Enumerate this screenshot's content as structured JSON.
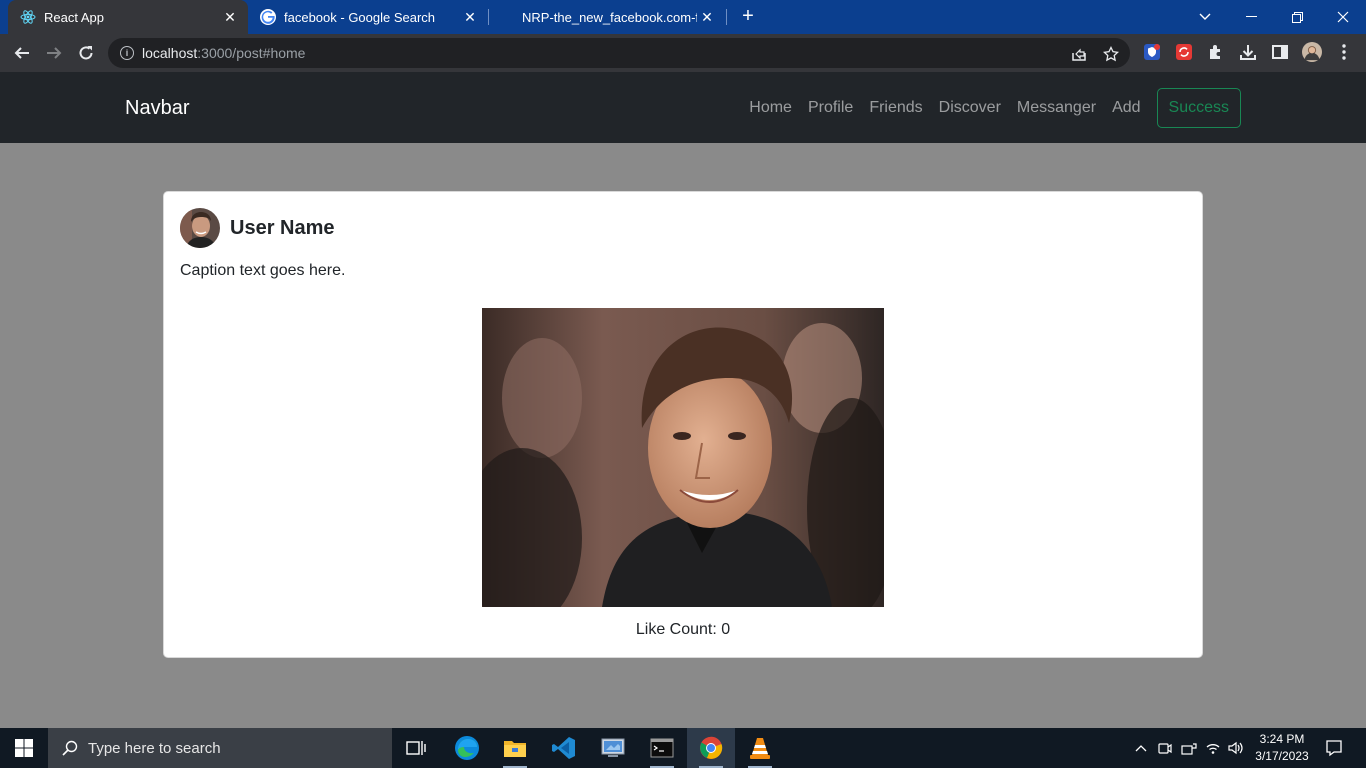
{
  "browser": {
    "tabs": [
      {
        "title": "React App",
        "favicon": "react-icon",
        "active": true
      },
      {
        "title": "facebook - Google Search",
        "favicon": "google-icon",
        "active": false
      },
      {
        "title": "NRP-the_new_facebook.com-final",
        "favicon": "none",
        "active": false
      }
    ],
    "new_tab_label": "+",
    "address": {
      "host": "localhost",
      "path": ":3000/post#home"
    }
  },
  "navbar": {
    "brand": "Navbar",
    "links": [
      "Home",
      "Profile",
      "Friends",
      "Discover",
      "Messanger",
      "Add"
    ],
    "button_label": "Success",
    "button_color": "#198754"
  },
  "post": {
    "user_name": "User Name",
    "caption": "Caption text goes here.",
    "like_label": "Like Count: 0"
  },
  "taskbar": {
    "search_placeholder": "Type here to search",
    "time": "3:24 PM",
    "date": "3/17/2023",
    "pinned": [
      "task-view-icon",
      "edge-icon",
      "file-explorer-icon",
      "vscode-icon",
      "control-panel-icon",
      "terminal-icon",
      "chrome-icon",
      "vlc-icon"
    ]
  },
  "colors": {
    "tabstrip": "#0b3f8f",
    "toolbar": "#35363a",
    "navbar": "#212529",
    "page_bg": "#8a8a8a",
    "taskbar": "#101923"
  }
}
